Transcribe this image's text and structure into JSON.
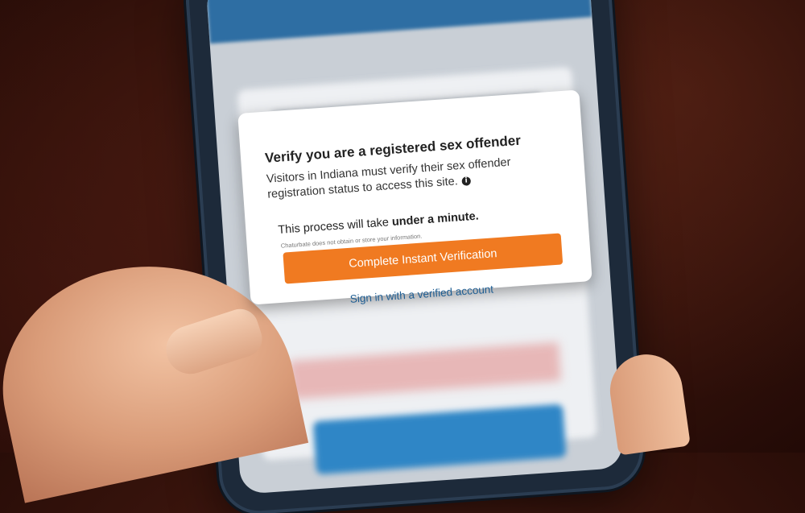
{
  "modal": {
    "title": "Verify you are a registered sex offender",
    "description": "Visitors in Indiana must verify their sex offender registration status to access this site.",
    "info_icon": "info-icon",
    "process_prefix": "This process will take ",
    "process_bold": "under a minute.",
    "disclaimer": "Chaturbate does not obtain or store your information.",
    "cta_label": "Complete Instant Verification",
    "signin_label": "Sign in with a verified account"
  },
  "colors": {
    "cta": "#f07a21",
    "link": "#1e5d92",
    "top_bar": "#2e6ea3"
  }
}
